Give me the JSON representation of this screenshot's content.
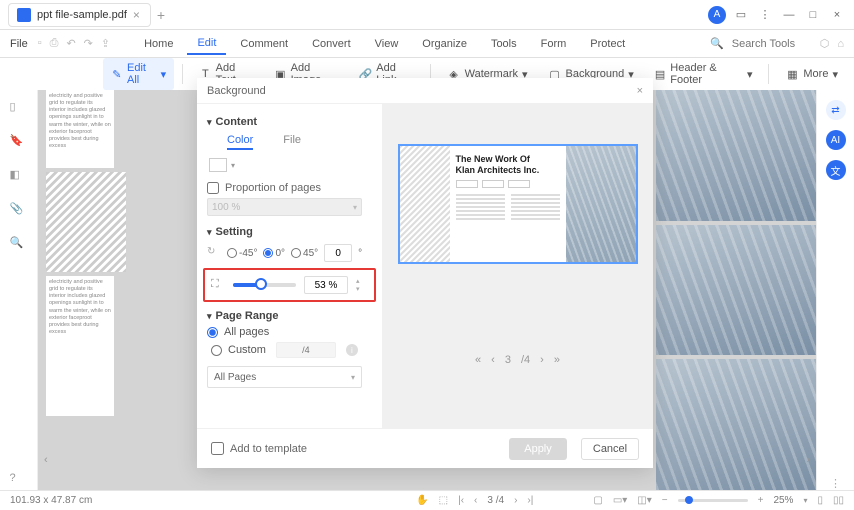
{
  "titlebar": {
    "tab_name": "ppt file-sample.pdf",
    "avatar_letter": "A"
  },
  "menubar": {
    "file": "File",
    "items": [
      "Home",
      "Edit",
      "Comment",
      "Convert",
      "View",
      "Organize",
      "Tools",
      "Form",
      "Protect"
    ],
    "active_index": 1,
    "search_placeholder": "Search Tools"
  },
  "toolbar": {
    "edit_all": "Edit All",
    "add_text": "Add Text",
    "add_image": "Add Image",
    "add_link": "Add Link",
    "watermark": "Watermark",
    "background": "Background",
    "header_footer": "Header & Footer",
    "more": "More"
  },
  "dialog": {
    "title": "Background",
    "content_h": "Content",
    "tab_color": "Color",
    "tab_file": "File",
    "proportion_label": "Proportion of pages",
    "proportion_value": "100 %",
    "setting_h": "Setting",
    "rotation": {
      "opts": [
        "-45°",
        "0°",
        "45°"
      ],
      "selected": "0°",
      "custom_value": "0",
      "custom_unit": "°"
    },
    "scale": {
      "value": 53,
      "display": "53 %"
    },
    "page_range_h": "Page Range",
    "all_pages": "All pages",
    "custom": "Custom",
    "custom_placeholder": "/4",
    "select_label": "All Pages",
    "add_to_template": "Add to template",
    "apply": "Apply",
    "cancel": "Cancel",
    "preview": {
      "title1": "The New Work Of",
      "title2": "Klan Architects Inc."
    },
    "pager": {
      "current": "3",
      "total": "/4"
    }
  },
  "statusbar": {
    "coords": "101.93 x 47.87 cm",
    "page": "3 /4",
    "zoom": "25%"
  },
  "doc_text": "electricity and positive grid to regulate its interior includes glazed openings sunlight in to warm the winter, while on exterior faceproot provides best during excess"
}
